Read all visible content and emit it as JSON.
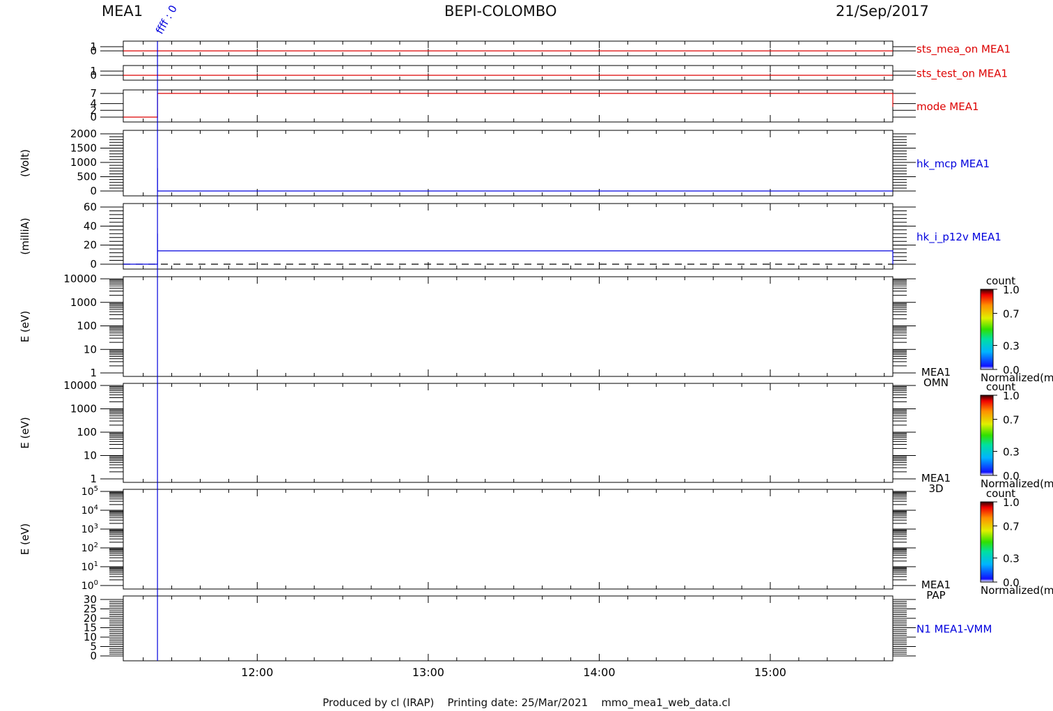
{
  "header": {
    "left": "MEA1",
    "center": "BEPI-COLOMBO",
    "right": "21/Sep/2017"
  },
  "footer": "Produced by cl (IRAP)    Printing date: 25/Mar/2021    mmo_mea1_web_data.cl",
  "colors": {
    "red_trace": "#dd0000",
    "blue_trace": "#0000dd",
    "axis": "#000000"
  },
  "chart_data": {
    "type": "line",
    "x_axis": {
      "type": "time",
      "start": "11:13",
      "end": "15:43",
      "tick_labels": [
        "12:00",
        "13:00",
        "14:00",
        "15:00"
      ]
    },
    "event_marker": {
      "time": "11:25",
      "label": "ffff : 0"
    },
    "panels": [
      {
        "id": "sts_mea_on",
        "label": "sts_mea_on MEA1",
        "label_color": "#dd0000",
        "ylabel": "",
        "yrange": [
          0,
          1
        ],
        "yticks": [
          "0",
          "1"
        ],
        "series": [
          {
            "color": "#dd0000",
            "points": [
              [
                "11:13",
                0
              ],
              [
                "15:43",
                0
              ]
            ]
          }
        ]
      },
      {
        "id": "sts_test_on",
        "label": "sts_test_on MEA1",
        "label_color": "#dd0000",
        "ylabel": "",
        "yrange": [
          0,
          1
        ],
        "yticks": [
          "0",
          "1"
        ],
        "series": [
          {
            "color": "#dd0000",
            "points": [
              [
                "11:13",
                0
              ],
              [
                "15:43",
                0
              ]
            ]
          }
        ]
      },
      {
        "id": "mode",
        "label": "mode MEA1",
        "label_color": "#dd0000",
        "ylabel": "",
        "yrange": [
          0,
          7
        ],
        "yticks": [
          "0",
          "2",
          "4",
          "7"
        ],
        "series": [
          {
            "color": "#dd0000",
            "points": [
              [
                "11:13",
                0
              ],
              [
                "11:25",
                0
              ],
              [
                "11:25",
                7
              ],
              [
                "15:43",
                7
              ],
              [
                "15:43",
                3
              ]
            ]
          }
        ]
      },
      {
        "id": "hk_mcp",
        "label": "hk_mcp MEA1",
        "label_color": "#0000dd",
        "ylabel": "(Volt)",
        "yrange": [
          0,
          2000
        ],
        "yticks": [
          "0",
          "500",
          "1000",
          "1500",
          "2000"
        ],
        "series": [
          {
            "color": "#0000dd",
            "points": [
              [
                "11:25",
                0
              ],
              [
                "11:25",
                800
              ],
              [
                "11:25",
                0
              ],
              [
                "15:43",
                0
              ]
            ]
          }
        ]
      },
      {
        "id": "hk_i_p12v",
        "label": "hk_i_p12v MEA1",
        "label_color": "#0000dd",
        "ylabel": "(milliA)",
        "yrange": [
          0,
          60
        ],
        "yticks": [
          "0",
          "20",
          "40",
          "60"
        ],
        "zero_line": "dashed",
        "series": [
          {
            "color": "#0000dd",
            "points": [
              [
                "11:13",
                0
              ],
              [
                "11:25",
                0
              ],
              [
                "11:25",
                32
              ],
              [
                "11:25",
                14
              ],
              [
                "15:43",
                14
              ],
              [
                "15:43",
                0
              ]
            ]
          }
        ]
      },
      {
        "id": "omn",
        "type": "spectrogram",
        "label": "MEA1",
        "sublabel": "OMN",
        "ylabel": "E (eV)",
        "scale": "log",
        "yrange": [
          1,
          10000
        ],
        "yticks": [
          "1",
          "10",
          "100",
          "1000",
          "10000"
        ],
        "colorbar": {
          "title": "count",
          "ticks": [
            "0.0",
            "0.3",
            "0.7",
            "1.0"
          ],
          "label": "Normalized(m"
        }
      },
      {
        "id": "3d",
        "type": "spectrogram",
        "label": "MEA1",
        "sublabel": "3D",
        "ylabel": "E (eV)",
        "scale": "log",
        "yrange": [
          1,
          10000
        ],
        "yticks": [
          "1",
          "10",
          "100",
          "1000",
          "10000"
        ],
        "colorbar": {
          "title": "count",
          "ticks": [
            "0.0",
            "0.3",
            "0.7",
            "1.0"
          ],
          "label": "Normalized(m"
        }
      },
      {
        "id": "pap",
        "type": "spectrogram",
        "label": "MEA1",
        "sublabel": "PAP",
        "ylabel": "E (eV)",
        "scale": "log",
        "yrange": [
          1,
          100000
        ],
        "yticks": [
          {
            "base": "10",
            "exp": "0"
          },
          {
            "base": "10",
            "exp": "1"
          },
          {
            "base": "10",
            "exp": "2"
          },
          {
            "base": "10",
            "exp": "3"
          },
          {
            "base": "10",
            "exp": "4"
          },
          {
            "base": "10",
            "exp": "5"
          }
        ],
        "colorbar": {
          "title": "count",
          "ticks": [
            "0.0",
            "0.3",
            "0.7",
            "1.0"
          ],
          "label": "Normalized(m"
        }
      },
      {
        "id": "vmm",
        "label": "N1 MEA1-VMM",
        "label_color": "#0000dd",
        "ylabel": "",
        "yrange": [
          0,
          30
        ],
        "yticks": [
          "0",
          "5",
          "10",
          "15",
          "20",
          "25",
          "30"
        ],
        "series": []
      }
    ]
  }
}
